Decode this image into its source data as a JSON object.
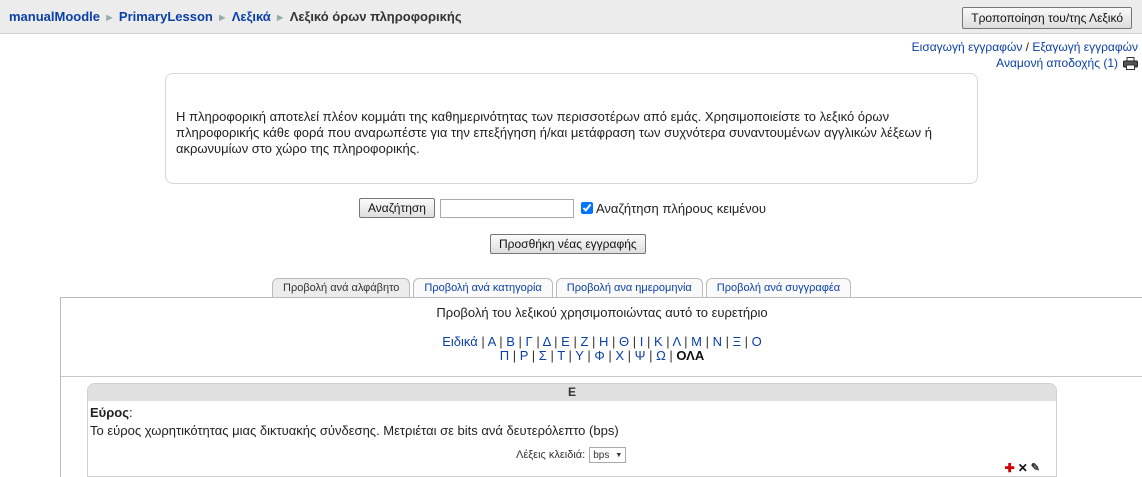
{
  "breadcrumb": [
    "manualMoodle",
    "PrimaryLesson",
    "Λεξικά",
    "Λεξικό όρων πληροφορικής"
  ],
  "header": {
    "edit_button": "Τροποποίηση του/της Λεξικό"
  },
  "io_links": {
    "import": "Εισαγωγή εγγραφών",
    "separator": "/",
    "export": "Εξαγωγή εγγραφών",
    "pending": "Αναμονή αποδοχής (1)"
  },
  "intro": "Η πληροφορική αποτελεί πλέον κομμάτι της καθημερινότητας των περισσοτέρων από εμάς. Χρησιμοποιείστε το λεξικό όρων πληροφορικής κάθε φορά που αναρωπέστε για την επεξήγηση ή/και μετάφραση των συχνότερα συναντουμένων αγγλικών λέξεων ή ακρωνυμίων στο χώρο της πληροφορικής.",
  "search": {
    "button": "Αναζήτηση",
    "value": "",
    "fulltext_label": "Αναζήτηση πλήρους κειμένου",
    "fulltext_checked": true
  },
  "add_entry": "Προσθήκη νέας εγγραφής",
  "tabs": [
    {
      "label": "Προβολή ανά αλφάβητο",
      "active": true
    },
    {
      "label": "Προβολή ανά κατηγορία",
      "active": false
    },
    {
      "label": "Προβολή ανα ημερομηνία",
      "active": false
    },
    {
      "label": "Προβολή ανά συγγραφέα",
      "active": false
    }
  ],
  "index": {
    "title": "Προβολή του λεξικού χρησιμοποιώντας αυτό το ευρετήριο",
    "line1": [
      "Ειδικά",
      "Α",
      "Β",
      "Γ",
      "Δ",
      "Ε",
      "Ζ",
      "Η",
      "Θ",
      "Ι",
      "Κ",
      "Λ",
      "Μ",
      "Ν",
      "Ξ",
      "Ο"
    ],
    "line2": [
      "Π",
      "Ρ",
      "Σ",
      "Τ",
      "Υ",
      "Φ",
      "Χ",
      "Ψ",
      "Ω"
    ],
    "all": "ΟΛΑ"
  },
  "entry": {
    "letter": "Ε",
    "concept": "Εύρος",
    "definition": "Το εύρος χωρητικότητας μιας δικτυακής σύνδεσης. Μετριέται σε bits ανά δευτερόλεπτο (bps)",
    "keywords_label": "Λέξεις κλειδιά:",
    "keyword_selected": "bps"
  }
}
